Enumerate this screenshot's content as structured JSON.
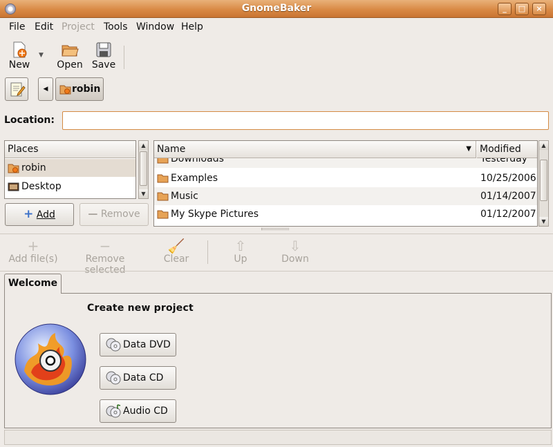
{
  "window": {
    "title": "GnomeBaker"
  },
  "menubar": {
    "items": [
      "File",
      "Edit",
      "Project",
      "Tools",
      "Window",
      "Help"
    ]
  },
  "toolbar": {
    "new": "New",
    "open": "Open",
    "save": "Save"
  },
  "pathbar": {
    "crumb": "robin"
  },
  "location": {
    "label": "Location:",
    "value": ""
  },
  "places": {
    "header": "Places",
    "items": [
      {
        "label": "robin",
        "icon": "home-folder-icon"
      },
      {
        "label": "Desktop",
        "icon": "desktop-icon"
      }
    ],
    "add_label": "Add",
    "remove_label": "Remove"
  },
  "files": {
    "columns": [
      "Name",
      "Modified"
    ],
    "rows": [
      {
        "name": "Downloads",
        "modified": "Yesterday"
      },
      {
        "name": "Examples",
        "modified": "10/25/2006"
      },
      {
        "name": "Music",
        "modified": "01/14/2007"
      },
      {
        "name": "My Skype Pictures",
        "modified": "01/12/2007"
      }
    ]
  },
  "project_toolbar": {
    "add_files": "Add file(s)",
    "remove_selected": "Remove selected",
    "clear": "Clear",
    "up": "Up",
    "down": "Down"
  },
  "tabs": {
    "welcome": "Welcome"
  },
  "welcome": {
    "title": "Create new project",
    "buttons": [
      "Data DVD",
      "Data CD",
      "Audio CD"
    ]
  },
  "colors": {
    "titlebar": "#d98a45",
    "accent": "#d48a43"
  }
}
